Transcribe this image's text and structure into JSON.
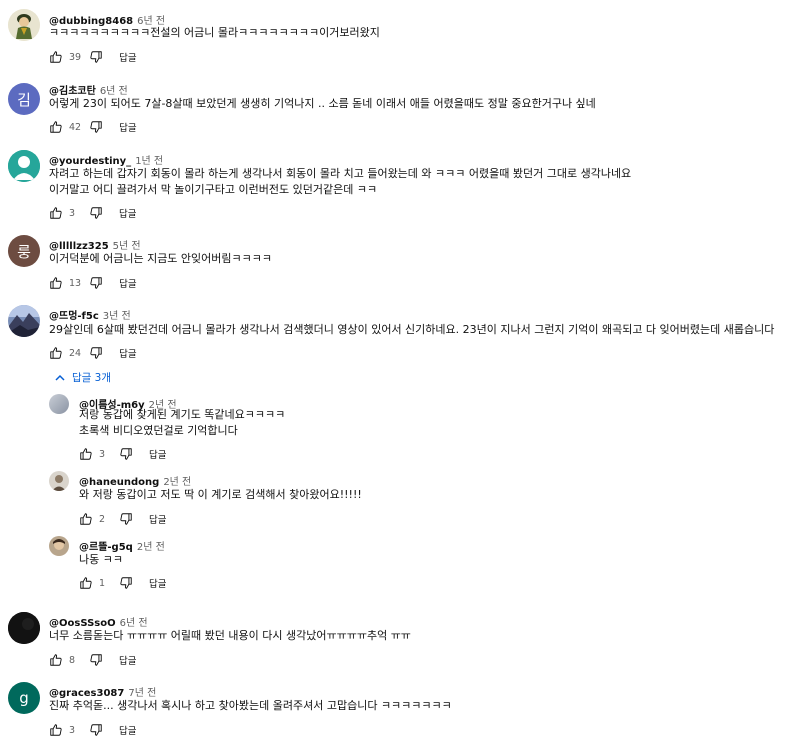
{
  "labels": {
    "reply": "답글"
  },
  "colors": {
    "link": "#065fd4",
    "avatar_kim": "#5c6bc0",
    "avatar_teal": "#26a69a",
    "avatar_rung": "#6d4c41",
    "avatar_g": "#00695c"
  },
  "comments": [
    {
      "author": "@dubbing8468",
      "time": "6년 전",
      "lines": [
        "ㅋㅋㅋㅋㅋㅋㅋㅋㅋㅋ전설의 어금니 몰라ㅋㅋㅋㅋㅋㅋㅋㅋ이거보러왔지"
      ],
      "likes": "39",
      "avatar_icon": "cartoon-character-avatar"
    },
    {
      "author": "@김초코탄",
      "time": "6년 전",
      "lines": [
        "어렇게 23이 되어도 7살-8살때 보았던게 생생히 기억나지 .. 소름 돋네 이래서 애들 어렸을때도 정말 중요한거구나 싶네"
      ],
      "likes": "42",
      "avatar_letter": "김"
    },
    {
      "author": "@yourdestiny_",
      "time": "1년 전",
      "lines": [
        "자려고 하는데 갑자기 회동이 몰라 하는게 생각나서 회동이 몰라 치고 들어왔는데 와 ㅋㅋㅋ 어렸을때 봤던거 그대로 생각나네요",
        "이거말고 어디 끌려가서 막 놀이기구타고 이런버전도 있던거같은데 ㅋㅋ"
      ],
      "likes": "3",
      "avatar_icon": "default-person-avatar"
    },
    {
      "author": "@lllllzz325",
      "time": "5년 전",
      "lines": [
        "이거덕분에 어금니는 지금도 안잊어버림ㅋㅋㅋㅋ"
      ],
      "likes": "13",
      "avatar_letter": "룽"
    },
    {
      "author": "@뜨멍-f5c",
      "time": "3년 전",
      "lines": [
        "29살인데 6살때 봤던건데 어금니 몰라가 생각나서 검색했더니 영상이 있어서 신기하네요. 23년이 지나서 그런지 기억이 왜곡되고 다 잊어버렸는데 새롭습니다"
      ],
      "likes": "24",
      "avatar_icon": "mountain-landscape-avatar"
    },
    {
      "author": "@OosSSsoO",
      "time": "6년 전",
      "lines": [
        "너무 소름돋는다 ㅠㅠㅠㅠ  어릴때 봤던 내용이 다시 생각났어ㅠㅠㅠㅠ추억 ㅠㅠ"
      ],
      "likes": "8",
      "avatar_icon": "dark-avatar"
    },
    {
      "author": "@graces3087",
      "time": "7년 전",
      "lines": [
        "진짜 추억돋... 생각나서 혹시나 하고 찾아봤는데 올려주셔서 고맙습니다 ㅋㅋㅋㅋㅋㅋㅋ"
      ],
      "likes": "3",
      "avatar_letter": "g"
    }
  ],
  "replies_toggle": {
    "label": "답글 3개"
  },
  "replies": [
    {
      "author": "@이름성-m6y",
      "time": "2년 전",
      "lines": [
        "저랑 동갑에 찾게된 계기도 똑같네요ㅋㅋㅋㅋ",
        "초록색 비디오였던걸로 기억합니다"
      ],
      "likes": "3",
      "avatar_icon": "grey-gradient-avatar"
    },
    {
      "author": "@haneundong",
      "time": "2년 전",
      "lines": [
        "와 저랑 동갑이고 저도 딱 이 계기로 검색해서 찾아왔어요!!!!!"
      ],
      "likes": "2",
      "avatar_icon": "photo-avatar"
    },
    {
      "author": "@르뜰-g5q",
      "time": "2년 전",
      "lines": [
        "나동 ㅋㅋ"
      ],
      "likes": "1",
      "avatar_icon": "face-photo-avatar"
    }
  ]
}
